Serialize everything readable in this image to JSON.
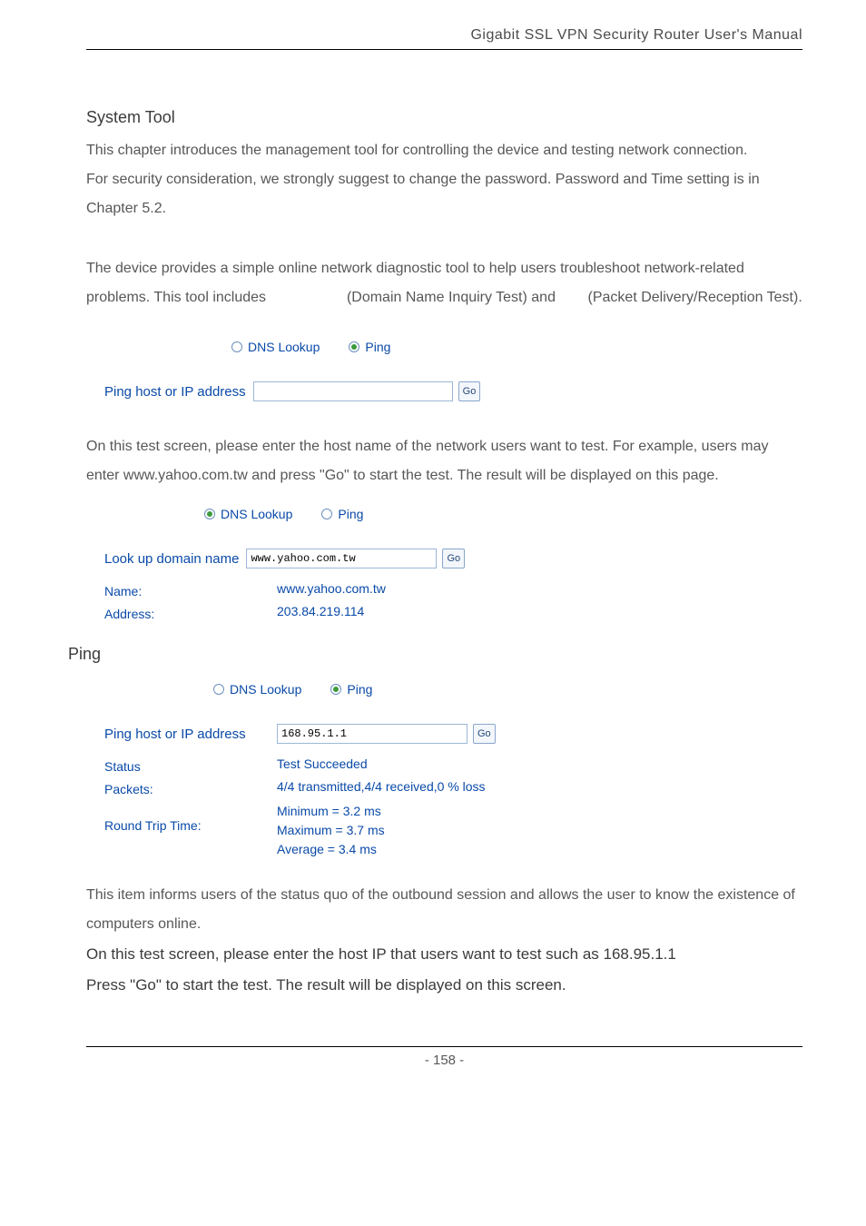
{
  "header": {
    "title": "Gigabit SSL VPN Security Router User's Manual"
  },
  "sections": {
    "system_tool": {
      "heading": "System Tool",
      "p1": "This chapter introduces the management tool for controlling the device and testing network connection.",
      "p2": "For security consideration, we strongly suggest to change the password. Password and Time setting is in Chapter 5.2.",
      "p3_a": "The device provides a simple online network diagnostic tool to help users troubleshoot network-related problems. This tool includes",
      "p3_b": "(Domain Name Inquiry Test) and",
      "p3_c": "(Packet Delivery/Reception Test)."
    },
    "diag_top": {
      "radio_dns": "DNS Lookup",
      "radio_ping": "Ping",
      "ping_host_label": "Ping host or IP address",
      "ping_host_value": "",
      "go": "Go"
    },
    "dns_desc": {
      "p1": "On this test screen, please enter the host name of the network users want to test. For example, users may enter www.yahoo.com.tw and press \"Go\" to start the test. The result will be displayed on this page."
    },
    "dns_block": {
      "radio_dns": "DNS Lookup",
      "radio_ping": "Ping",
      "lookup_label": "Look up domain name",
      "lookup_value": "www.yahoo.com.tw",
      "go": "Go",
      "name_label": "Name:",
      "name_value": "www.yahoo.com.tw",
      "addr_label": "Address:",
      "addr_value": "203.84.219.114"
    },
    "ping": {
      "heading": "Ping",
      "radio_dns": "DNS Lookup",
      "radio_ping": "Ping",
      "host_label": "Ping host or IP address",
      "host_value": "168.95.1.1",
      "go": "Go",
      "status_label": "Status",
      "status_value": "Test Succeeded",
      "packets_label": "Packets:",
      "packets_value": "4/4 transmitted,4/4 received,0 % loss",
      "rtt_label": "Round Trip Time:",
      "rtt_line1": "Minimum = 3.2 ms",
      "rtt_line2": "Maximum = 3.7 ms",
      "rtt_line3": "Average = 3.4 ms"
    },
    "ping_desc": {
      "p1": "This item informs users of the status quo of the outbound session and allows the user to know the existence of computers online.",
      "p2": "On this test screen, please enter the host IP that users want to test such as 168.95.1.1",
      "p3": "Press \"Go\" to start the test. The result will be displayed on this screen."
    }
  },
  "footer": {
    "page": "- 158 -"
  }
}
